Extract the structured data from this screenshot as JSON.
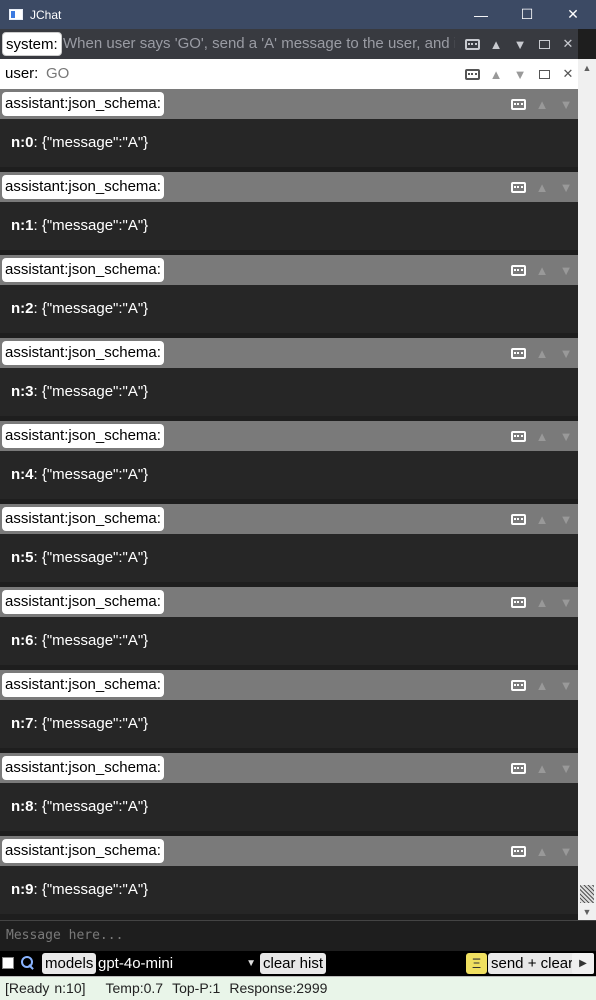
{
  "window": {
    "title": "JChat",
    "minimize": "—",
    "maximize": "☐",
    "close": "✕"
  },
  "prompts": {
    "system_label": "system:",
    "system_text": "When user says 'GO', send a 'A' message to the user, and im...",
    "user_label": "user:",
    "user_text": "GO"
  },
  "messages": [
    {
      "role": "assistant:json_schema:",
      "n_label": "n:0",
      "content": ": {\"message\":\"A\"}"
    },
    {
      "role": "assistant:json_schema:",
      "n_label": "n:1",
      "content": ": {\"message\":\"A\"}"
    },
    {
      "role": "assistant:json_schema:",
      "n_label": "n:2",
      "content": ": {\"message\":\"A\"}"
    },
    {
      "role": "assistant:json_schema:",
      "n_label": "n:3",
      "content": ": {\"message\":\"A\"}"
    },
    {
      "role": "assistant:json_schema:",
      "n_label": "n:4",
      "content": ": {\"message\":\"A\"}"
    },
    {
      "role": "assistant:json_schema:",
      "n_label": "n:5",
      "content": ": {\"message\":\"A\"}"
    },
    {
      "role": "assistant:json_schema:",
      "n_label": "n:6",
      "content": ": {\"message\":\"A\"}"
    },
    {
      "role": "assistant:json_schema:",
      "n_label": "n:7",
      "content": ": {\"message\":\"A\"}"
    },
    {
      "role": "assistant:json_schema:",
      "n_label": "n:8",
      "content": ": {\"message\":\"A\"}"
    },
    {
      "role": "assistant:json_schema:",
      "n_label": "n:9",
      "content": ": {\"message\":\"A\"}"
    }
  ],
  "input": {
    "placeholder": "Message here..."
  },
  "toolbar": {
    "models_label": "models",
    "model_value": "gpt-4o-mini",
    "clear_hist_label": "clear hist",
    "menu_icon": "Ξ",
    "send_clear_label": "send + clear",
    "play_icon": "▶"
  },
  "status": {
    "ready": "[Ready",
    "n": "n:10]",
    "temp": "Temp:0.7",
    "top_p": "Top-P:1",
    "response": "Response:2999"
  },
  "colors": {
    "titlebar": "#3c4a64",
    "message_header": "#7a7a7a",
    "message_body": "#262626",
    "status_bar": "#e9f5e9",
    "menu_button": "#f0e060"
  },
  "icons": {
    "app": "app-window-icon",
    "message_bubble": "comment-bubble-icon",
    "move_up": "triangle-up-icon",
    "move_down": "triangle-down-icon",
    "expand": "maximize-box-icon",
    "remove": "close-x-icon",
    "search": "magnifier-icon",
    "dropdown": "chevron-down-icon"
  }
}
